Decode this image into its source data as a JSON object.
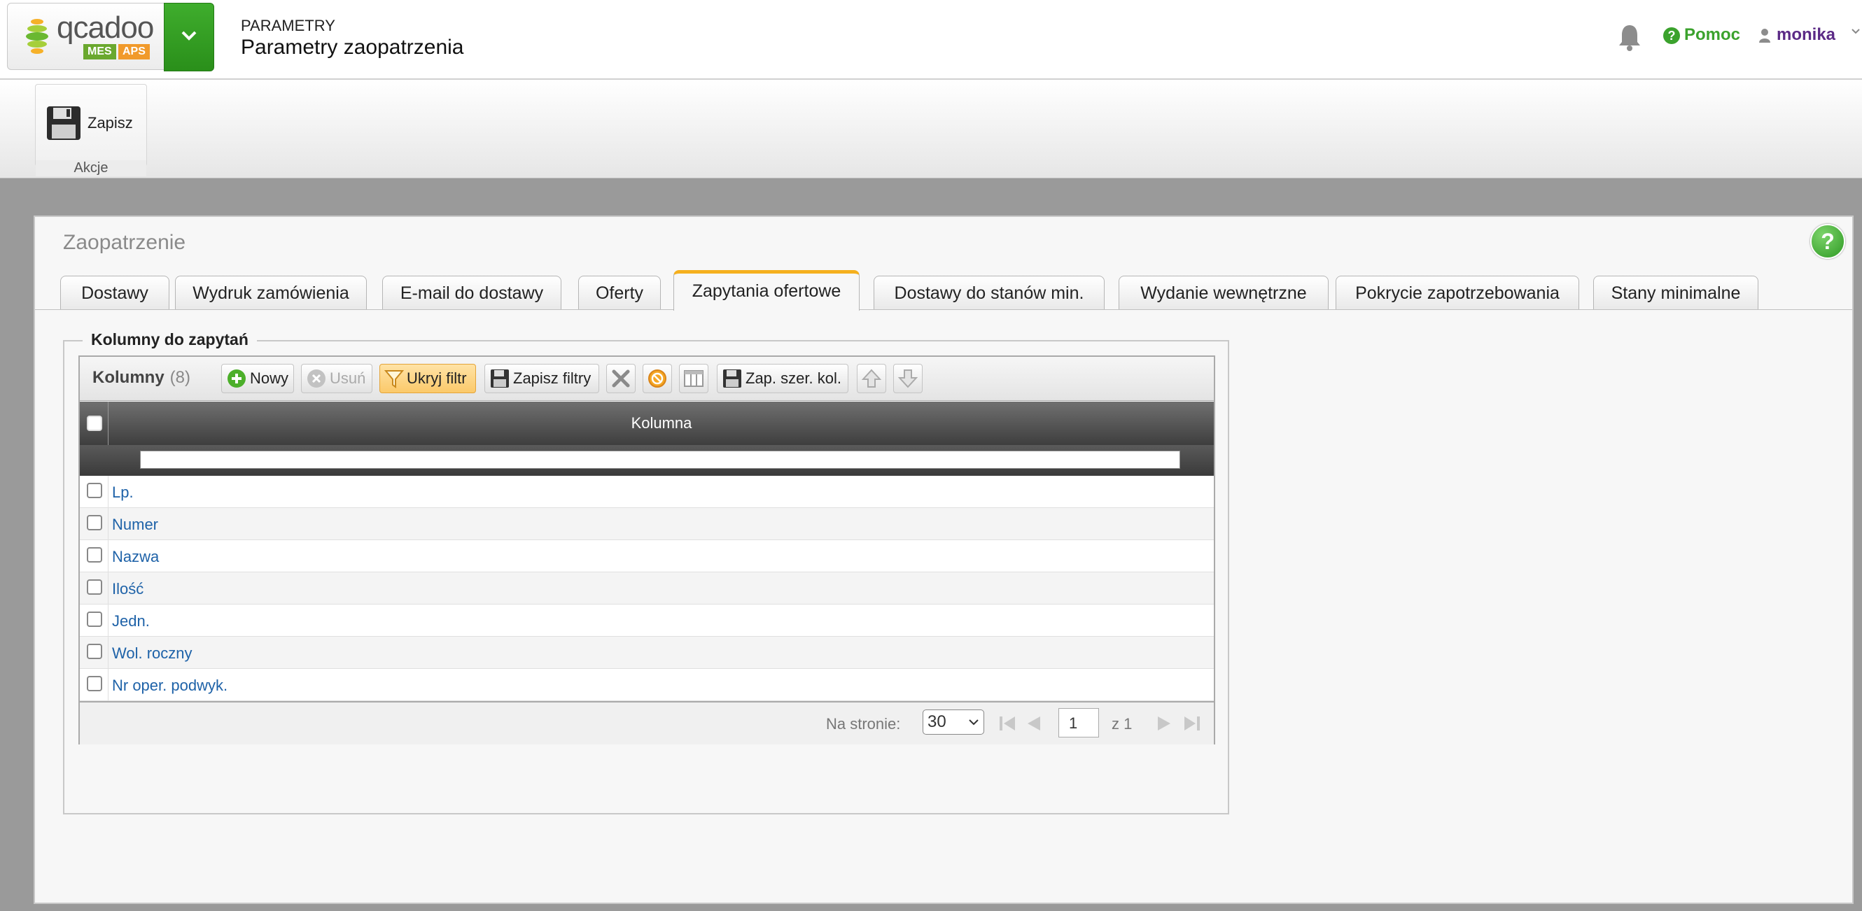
{
  "header": {
    "logo_text": "qcadoo",
    "badge_mes": "MES",
    "badge_aps": "APS",
    "breadcrumb_section": "PARAMETRY",
    "breadcrumb_page": "Parametry zaopatrzenia",
    "help_label": "Pomoc",
    "user_label": "monika"
  },
  "ribbon": {
    "save_label": "Zapisz",
    "group_label": "Akcje"
  },
  "window": {
    "title": "Zaopatrzenie",
    "help_glyph": "?",
    "tabs": [
      {
        "label": "Dostawy"
      },
      {
        "label": "Wydruk zamówienia"
      },
      {
        "label": "E-mail do dostawy"
      },
      {
        "label": "Oferty"
      },
      {
        "label": "Zapytania ofertowe"
      },
      {
        "label": "Dostawy do stanów min."
      },
      {
        "label": "Wydanie wewnętrzne"
      },
      {
        "label": "Pokrycie zapotrzebowania"
      },
      {
        "label": "Stany minimalne"
      }
    ],
    "active_tab": "Zapytania ofertowe"
  },
  "fieldset": {
    "legend": "Kolumny do zapytań"
  },
  "grid": {
    "title": "Kolumny",
    "count": "(8)",
    "toolbar": {
      "new_label": "Nowy",
      "delete_label": "Usuń",
      "hide_filter_label": "Ukryj filtr",
      "save_filters_label": "Zapisz filtry",
      "save_col_width_label": "Zap. szer. kol."
    },
    "column_header": "Kolumna",
    "rows": [
      {
        "value": "Lp."
      },
      {
        "value": "Numer"
      },
      {
        "value": "Nazwa"
      },
      {
        "value": "Ilość"
      },
      {
        "value": "Jedn."
      },
      {
        "value": "Wol. roczny"
      },
      {
        "value": "Nr oper. podwyk."
      }
    ],
    "pager": {
      "per_page_label": "Na stronie:",
      "per_page_value": "30",
      "current_page": "1",
      "of_label": "z 1"
    }
  },
  "colors": {
    "brand_green": "#3ba22d",
    "active_tab_accent": "#f5b01e",
    "link_blue": "#1e62a8",
    "user_purple": "#5b2a86"
  }
}
